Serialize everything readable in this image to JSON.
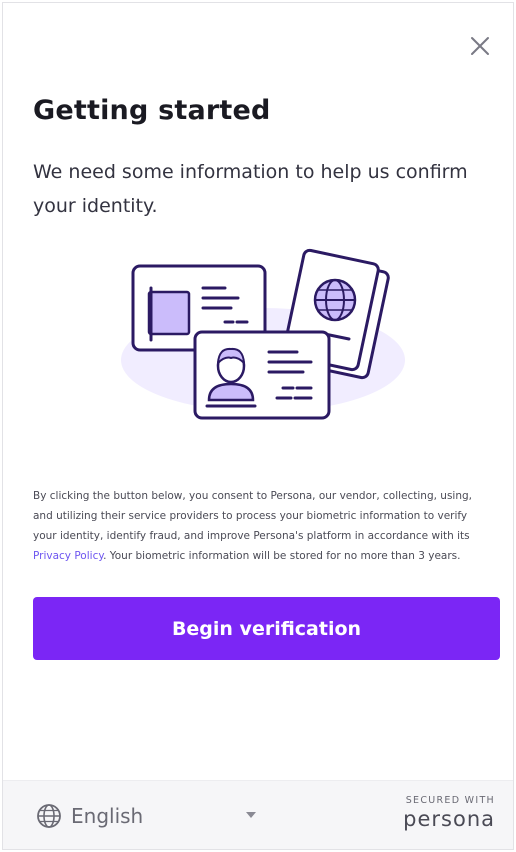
{
  "header": {
    "close_icon": "close-icon"
  },
  "content": {
    "title": "Getting started",
    "subtitle": "We need some information to help us confirm your identity.",
    "illustration": "identity-documents-illustration",
    "consent": {
      "text_before": "By clicking the button below, you consent to Persona, our vendor, collecting, using, and utilizing their service providers to process your biometric information to verify your identity, identify fraud, and improve Persona's platform in accordance with its ",
      "link_text": "Privacy Policy",
      "text_after": ". Your biometric information will be stored for no more than 3 years."
    },
    "cta_label": "Begin verification"
  },
  "footer": {
    "language": {
      "icon": "globe-icon",
      "selected": "English",
      "chevron_icon": "chevron-down-icon"
    },
    "secured_label": "SECURED WITH",
    "brand": "persona"
  },
  "colors": {
    "accent": "#7b26f5",
    "link": "#6d55f0",
    "illustration_outline": "#2b1a63",
    "illustration_fill": "#cbbcfb",
    "illustration_blob": "#f1edff"
  }
}
